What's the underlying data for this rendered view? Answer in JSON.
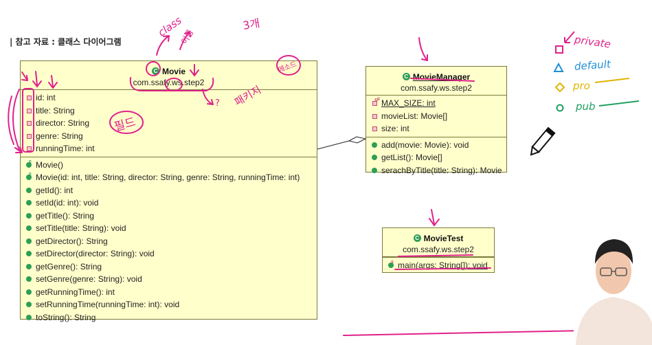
{
  "slide": {
    "title": "| 참고 자료 : 클래스 다이어그램"
  },
  "movie": {
    "name": "Movie",
    "package": "com.ssafy.ws.step2",
    "fields": [
      "id: int",
      "title: String",
      "director: String",
      "genre: String",
      "runningTime: int"
    ],
    "methods": [
      "Movie()",
      "Movie(id: int, title: String, director: String, genre: String, runningTime: int)",
      "getId(): int",
      "setId(id: int): void",
      "getTitle(): String",
      "setTitle(title: String): void",
      "getDirector(): String",
      "setDirector(director: String): void",
      "getGenre(): String",
      "setGenre(genre: String): void",
      "getRunningTime(): int",
      "setRunningTime(runningTime: int): void",
      "toString(): String"
    ]
  },
  "movieManager": {
    "name": "MovieManager",
    "package": "com.ssafy.ws.step2",
    "fields": [
      "MAX_SIZE: int",
      "movieList: Movie[]",
      "size: int"
    ],
    "methods": [
      "add(movie: Movie): void",
      "getList(): Movie[]",
      "serachByTitle(title: String): Movie"
    ]
  },
  "movieTest": {
    "name": "MovieTest",
    "package": "com.ssafy.ws.step2",
    "methods": [
      "main(args: String[]): void"
    ]
  },
  "annotations": {
    "class": "class",
    "name": "이름",
    "three": "3개",
    "package": "패키지",
    "q": "?",
    "field": "필드",
    "method": "메소드"
  },
  "legend": [
    {
      "label": "private",
      "color": "#e0218a"
    },
    {
      "label": "default",
      "color": "#1e8fd6"
    },
    {
      "label": "pro",
      "color": "#e0b400"
    },
    {
      "label": "pub",
      "color": "#1fa060"
    }
  ],
  "icons": {
    "pen": "pencil-icon"
  }
}
